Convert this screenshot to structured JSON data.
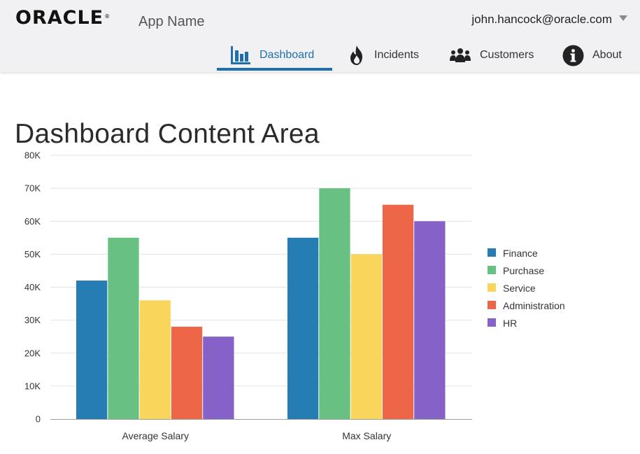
{
  "header": {
    "logo_text": "ORACLE",
    "logo_mark": "®",
    "app_name": "App Name",
    "user_email": "john.hancock@oracle.com",
    "user_menu_icon": "caret-down-icon"
  },
  "nav": {
    "active": "Dashboard",
    "accent_color": "#1f6fad",
    "items": [
      {
        "label": "Dashboard",
        "icon": "bar-chart-icon"
      },
      {
        "label": "Incidents",
        "icon": "fire-icon"
      },
      {
        "label": "Customers",
        "icon": "people-icon"
      },
      {
        "label": "About",
        "icon": "info-icon"
      }
    ]
  },
  "main": {
    "title": "Dashboard Content Area"
  },
  "chart_data": {
    "type": "bar",
    "categories": [
      "Average Salary",
      "Max Salary"
    ],
    "series": [
      {
        "name": "Finance",
        "color": "#267db3",
        "values": [
          42000,
          55000
        ]
      },
      {
        "name": "Purchase",
        "color": "#68c182",
        "values": [
          55000,
          70000
        ]
      },
      {
        "name": "Service",
        "color": "#fad55c",
        "values": [
          36000,
          50000
        ]
      },
      {
        "name": "Administration",
        "color": "#ed6647",
        "values": [
          28000,
          65000
        ]
      },
      {
        "name": "HR",
        "color": "#8561c8",
        "values": [
          25000,
          60000
        ]
      }
    ],
    "yticks": [
      "0",
      "10K",
      "20K",
      "30K",
      "40K",
      "50K",
      "60K",
      "70K",
      "80K"
    ],
    "ylim": [
      0,
      80000
    ],
    "grid": true,
    "legend_position": "right"
  }
}
